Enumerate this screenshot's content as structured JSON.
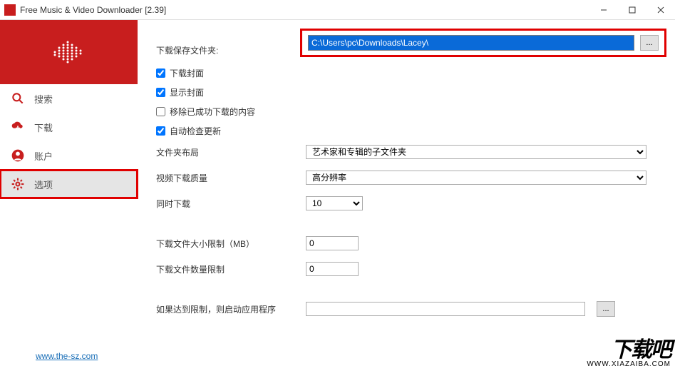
{
  "title": "Free Music & Video Downloader [2.39]",
  "sidebar": {
    "items": [
      {
        "label": "搜索",
        "icon": "search-icon"
      },
      {
        "label": "下载",
        "icon": "cloud-download-icon"
      },
      {
        "label": "账户",
        "icon": "user-icon"
      },
      {
        "label": "选项",
        "icon": "gear-icon"
      }
    ],
    "footer_link": "www.the-sz.com"
  },
  "settings": {
    "path_label": "下载保存文件夹:",
    "path_value": "C:\\Users\\pc\\Downloads\\Lacey\\",
    "browse": "...",
    "checks": {
      "download_cover": {
        "label": "下载封面",
        "checked": true
      },
      "show_cover": {
        "label": "显示封面",
        "checked": true
      },
      "remove_success": {
        "label": "移除已成功下载的内容",
        "checked": false
      },
      "auto_update": {
        "label": "自动检查更新",
        "checked": true
      }
    },
    "folder_layout_label": "文件夹布局",
    "folder_layout_value": "艺术家和专辑的子文件夹",
    "video_quality_label": "视频下载质量",
    "video_quality_value": "高分辨率",
    "concurrent_label": "同时下载",
    "concurrent_value": "10",
    "size_limit_label": "下载文件大小限制（MB）",
    "size_limit_value": "0",
    "count_limit_label": "下载文件数量限制",
    "count_limit_value": "0",
    "on_limit_label": "如果达到限制，则启动应用程序",
    "on_limit_value": "",
    "on_limit_browse": "..."
  },
  "watermark": {
    "big": "下载吧",
    "small": "WWW.XIAZAIBA.COM"
  }
}
